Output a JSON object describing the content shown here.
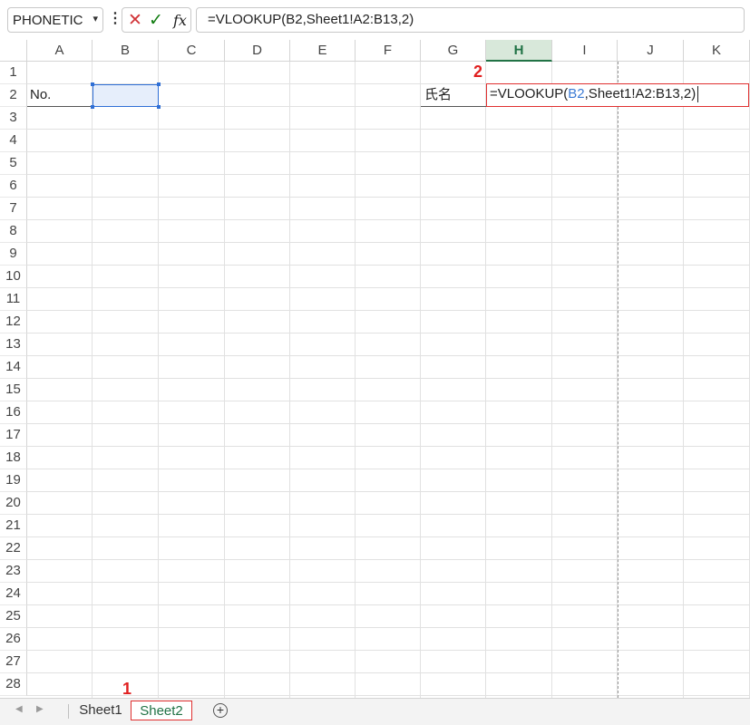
{
  "namebox": {
    "value": "PHONETIC",
    "chevron": "▾"
  },
  "formula_buttons": {
    "cancel": "✕",
    "enter": "✓",
    "fx": "fx"
  },
  "formula_bar": {
    "value": "=VLOOKUP(B2,Sheet1!A2:B13,2)"
  },
  "columns": [
    "A",
    "B",
    "C",
    "D",
    "E",
    "F",
    "G",
    "H",
    "I",
    "J",
    "K"
  ],
  "selected_column": "H",
  "rows": [
    "1",
    "2",
    "3",
    "4",
    "5",
    "6",
    "7",
    "8",
    "9",
    "10",
    "11",
    "12",
    "13",
    "14",
    "15",
    "16",
    "17",
    "18",
    "19",
    "20",
    "21",
    "22",
    "23",
    "24",
    "25",
    "26",
    "27",
    "28"
  ],
  "cells": {
    "A2": "No.",
    "G2": "氏名"
  },
  "edit_cell": {
    "prefix": "=VLOOKUP(",
    "ref": "B2",
    "suffix": ",Sheet1!A2:B13,2)"
  },
  "annotations": {
    "step1": "1",
    "step2": "2"
  },
  "sheet_tabs": [
    {
      "label": "Sheet1",
      "active": false
    },
    {
      "label": "Sheet2",
      "active": true
    }
  ],
  "add_sheet": "+",
  "colors": {
    "accent": "#217346",
    "annotation": "#e03030",
    "ref_blue": "#3b7bd4"
  }
}
